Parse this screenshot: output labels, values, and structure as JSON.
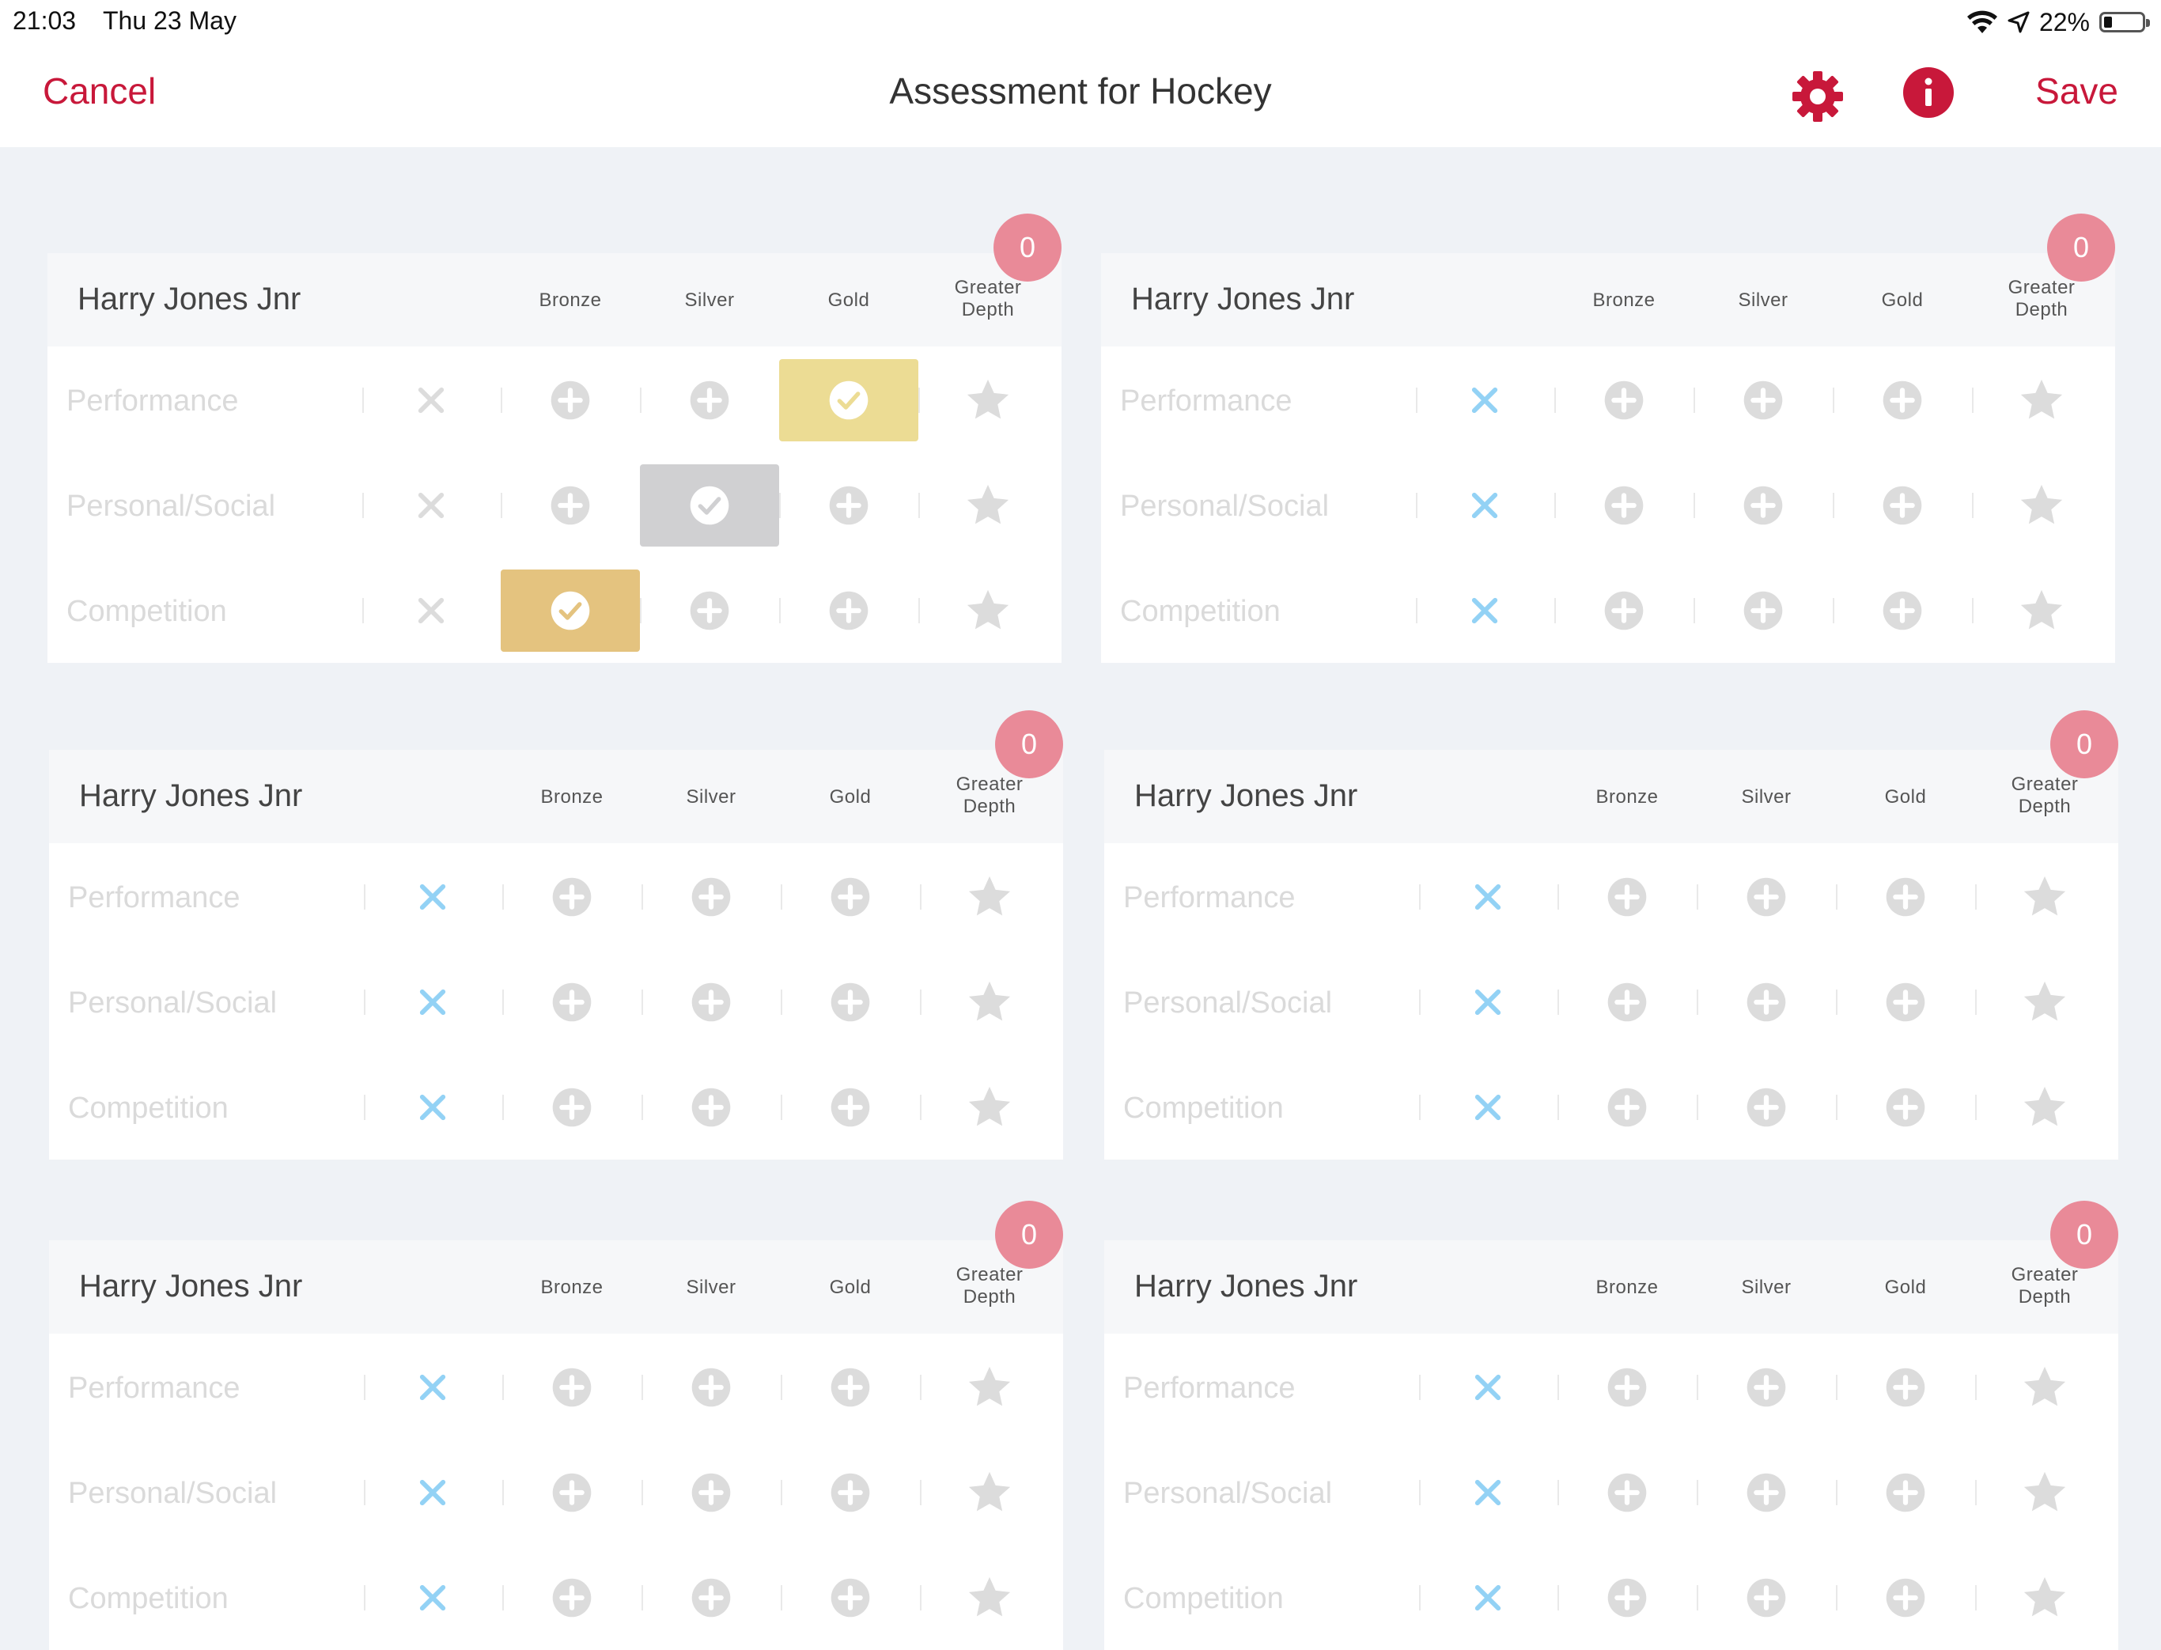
{
  "status_bar": {
    "time": "21:03",
    "date": "Thu 23 May",
    "battery_text": "22%",
    "battery_level": 0.22
  },
  "nav": {
    "cancel_label": "Cancel",
    "title": "Assessment for Hockey",
    "save_label": "Save",
    "settings_icon": "gear-icon",
    "info_icon": "info-icon",
    "accent_color": "#c8183a"
  },
  "level_headers": {
    "bronze": "Bronze",
    "silver": "Silver",
    "gold": "Gold",
    "greater_depth_line1": "Greater",
    "greater_depth_line2": "Depth"
  },
  "criteria": [
    "Performance",
    "Personal/Social",
    "Competition"
  ],
  "colors": {
    "not_achieved": "#93d2f5",
    "inactive": "#dcdcdc",
    "badge": "#e98a98",
    "gold_selected": "#ecdc94",
    "silver_selected": "#d0d0d2",
    "bronze_selected": "#e4c37f"
  },
  "students": [
    {
      "name": "Harry Jones Jnr",
      "score": "0",
      "selections": [
        "gold",
        "silver",
        "bronze"
      ]
    },
    {
      "name": "Harry Jones Jnr",
      "score": "0",
      "selections": [
        "none",
        "none",
        "none"
      ]
    },
    {
      "name": "Harry Jones Jnr",
      "score": "0",
      "selections": [
        "none",
        "none",
        "none"
      ]
    },
    {
      "name": "Harry Jones Jnr",
      "score": "0",
      "selections": [
        "none",
        "none",
        "none"
      ]
    },
    {
      "name": "Harry Jones Jnr",
      "score": "0",
      "selections": [
        "none",
        "none",
        "none"
      ]
    },
    {
      "name": "Harry Jones Jnr",
      "score": "0",
      "selections": [
        "none",
        "none",
        "none"
      ]
    }
  ]
}
